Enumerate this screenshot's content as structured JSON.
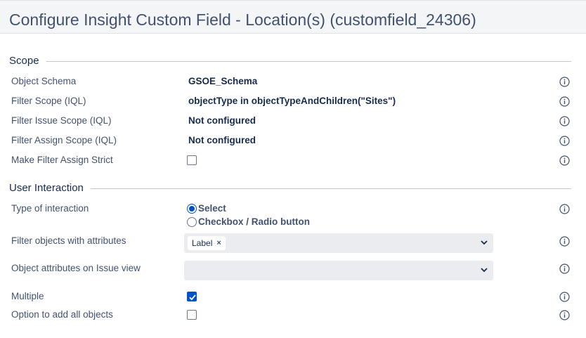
{
  "page": {
    "title": "Configure Insight Custom Field - Location(s) (customfield_24306)"
  },
  "sections": {
    "scope": "Scope",
    "user_interaction": "User Interaction"
  },
  "scope": {
    "object_schema": {
      "label": "Object Schema",
      "value": "GSOE_Schema"
    },
    "filter_scope": {
      "label": "Filter Scope (IQL)",
      "value": "objectType in objectTypeAndChildren(\"Sites\")"
    },
    "filter_issue_scope": {
      "label": "Filter Issue Scope (IQL)",
      "value": "Not configured"
    },
    "filter_assign_scope": {
      "label": "Filter Assign Scope (IQL)",
      "value": "Not configured"
    },
    "make_filter_assign_strict": {
      "label": "Make Filter Assign Strict",
      "checked": false
    }
  },
  "user_interaction": {
    "type_of_interaction": {
      "label": "Type of interaction",
      "options": [
        "Select",
        "Checkbox / Radio button"
      ],
      "selected": "Select"
    },
    "filter_objects_with_attributes": {
      "label": "Filter objects with attributes",
      "tags": [
        "Label"
      ],
      "remove_glyph": "×"
    },
    "object_attributes_on_issue_view": {
      "label": "Object attributes on Issue view",
      "tags": []
    },
    "multiple": {
      "label": "Multiple",
      "checked": true
    },
    "option_to_add_all_objects": {
      "label": "Option to add all objects",
      "checked": false
    }
  },
  "icons": {
    "info": "info-icon",
    "chevron": "chevron-down-icon",
    "check": "checkmark-icon"
  },
  "colors": {
    "accent": "#0052cc",
    "header_bg": "#f4f5f7",
    "select_bg": "#ebecf0",
    "text": "#172b4d",
    "label": "#42526e"
  }
}
